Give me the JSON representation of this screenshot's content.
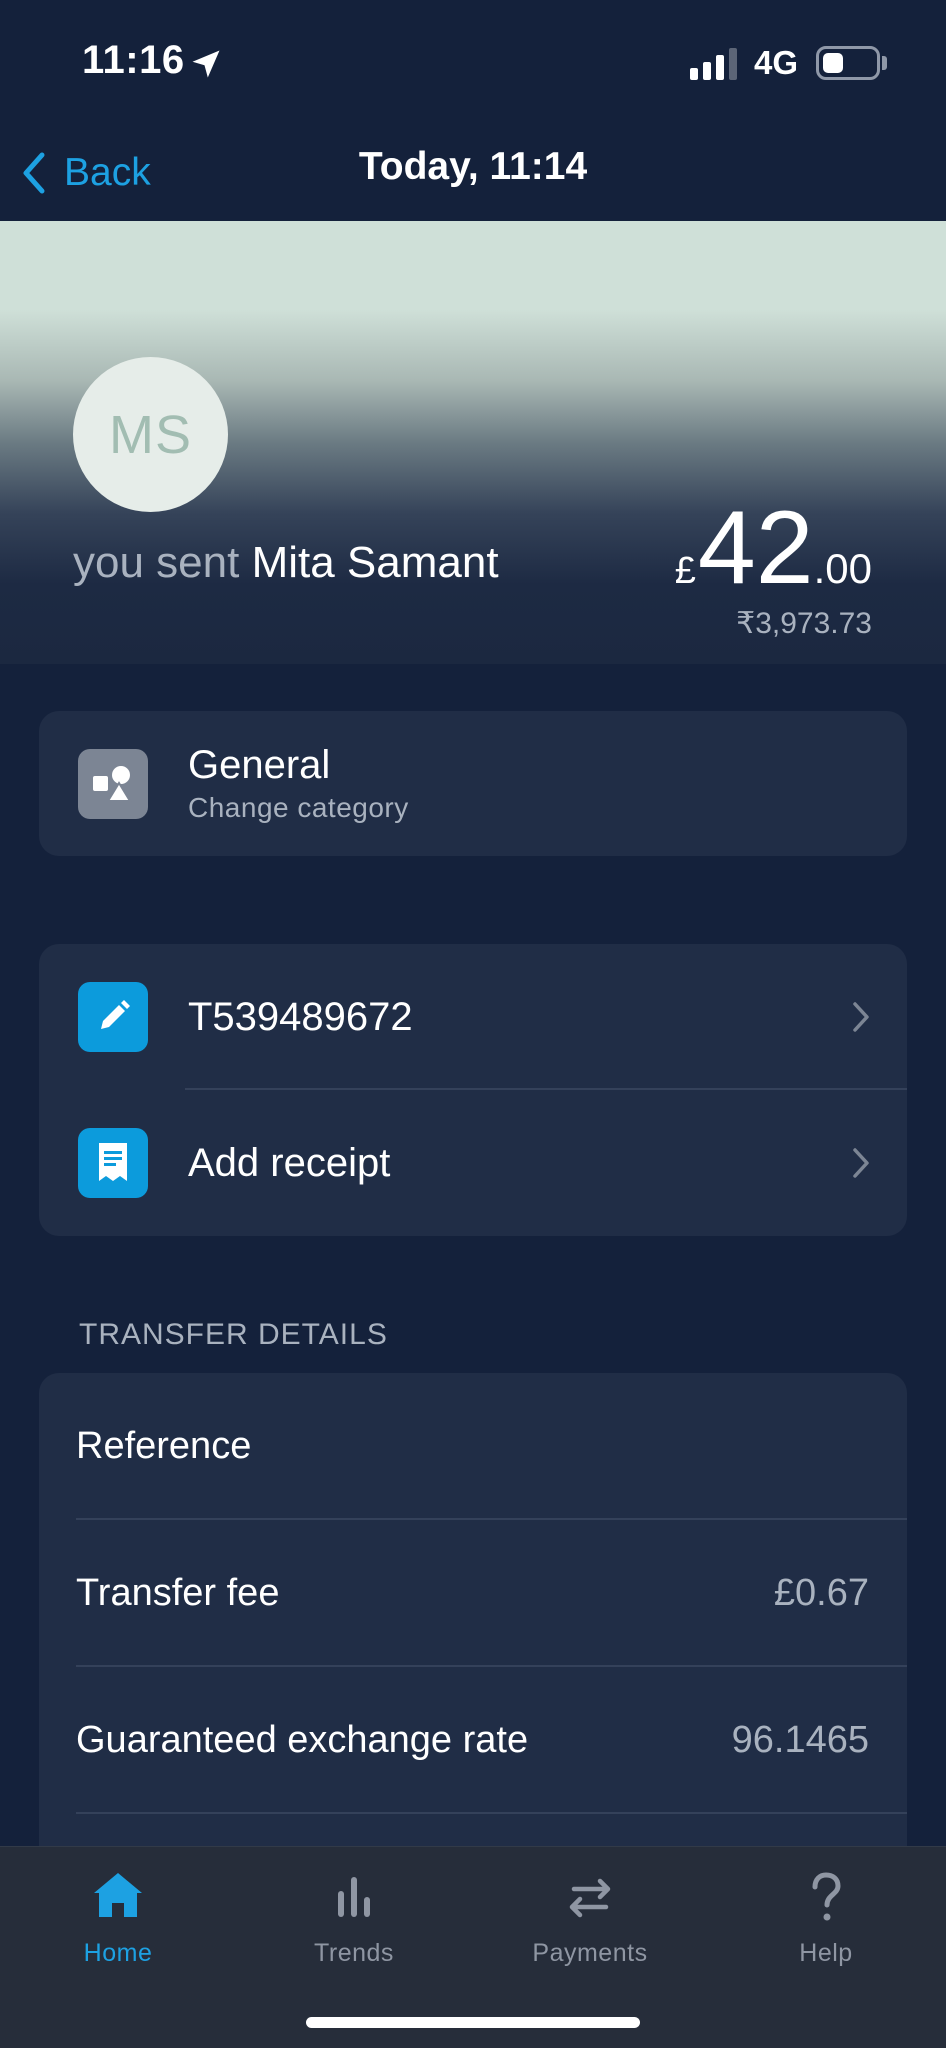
{
  "status_bar": {
    "time": "11:16",
    "network": "4G",
    "battery_level": 0.4
  },
  "nav": {
    "back_label": "Back",
    "title": "Today, 11:14"
  },
  "header": {
    "initials": "MS",
    "sent_prefix": "you sent",
    "recipient": "Mita Samant",
    "amount_currency": "£",
    "amount_whole": "42",
    "amount_fraction": ".00",
    "amount_converted": "₹3,973.73"
  },
  "category": {
    "title": "General",
    "subtitle": "Change category",
    "icon": "shapes-icon"
  },
  "actions": [
    {
      "label": "T539489672",
      "icon": "pencil-icon"
    },
    {
      "label": "Add receipt",
      "icon": "receipt-icon"
    }
  ],
  "transfer_details": {
    "heading": "TRANSFER DETAILS",
    "rows": [
      {
        "label": "Reference",
        "value": ""
      },
      {
        "label": "Transfer fee",
        "value": "£0.67"
      },
      {
        "label": "Guaranteed exchange rate",
        "value": "96.1465"
      }
    ]
  },
  "tabs": [
    {
      "label": "Home",
      "icon": "home-icon",
      "active": true
    },
    {
      "label": "Trends",
      "icon": "bar-chart-icon",
      "active": false
    },
    {
      "label": "Payments",
      "icon": "transfer-arrows-icon",
      "active": false
    },
    {
      "label": "Help",
      "icon": "question-mark-icon",
      "active": false
    }
  ],
  "colors": {
    "background": "#14213b",
    "card": "#202d46",
    "accent": "#1da1e2",
    "muted_text": "#a9b2bf",
    "tab_bar": "#262d3a"
  }
}
